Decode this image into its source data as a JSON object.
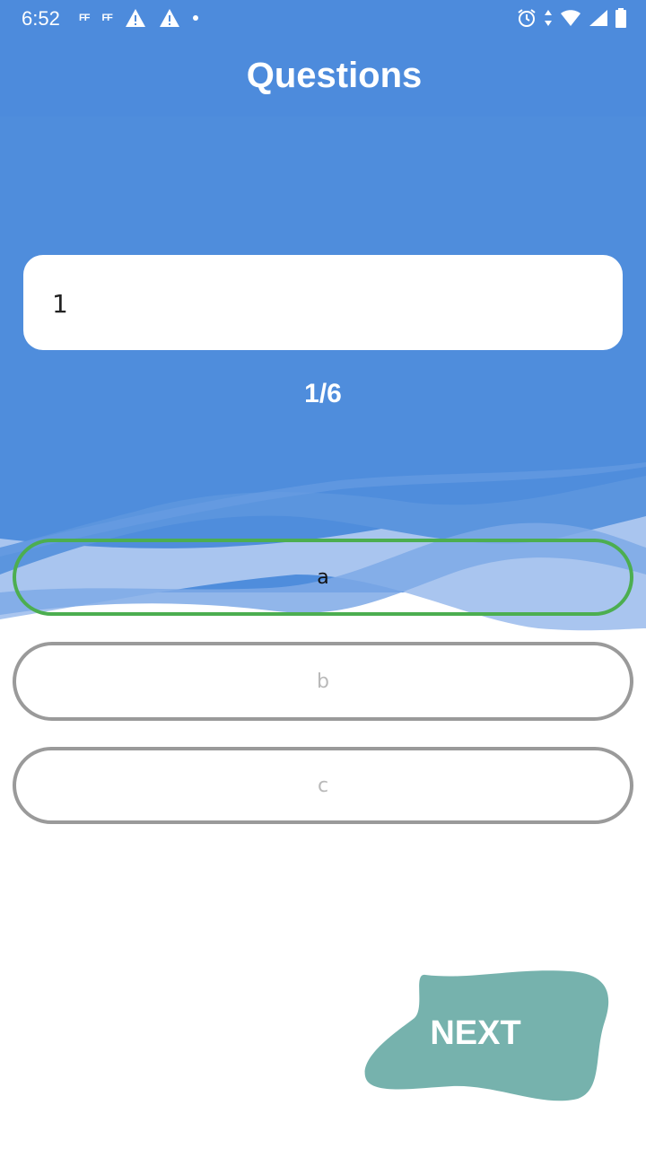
{
  "status_bar": {
    "time": "6:52",
    "left_icons": [
      "ff-icon",
      "ff-icon",
      "warning-icon",
      "warning-icon",
      "dot-icon"
    ],
    "ff_label": "FF",
    "right_icons": [
      "alarm-icon",
      "data-arrows-icon",
      "wifi-icon",
      "signal-icon",
      "battery-icon"
    ]
  },
  "app_bar": {
    "title": "Questions"
  },
  "question": {
    "text": "1"
  },
  "progress": {
    "text": "1/6",
    "current": 1,
    "total": 6
  },
  "options": [
    {
      "label": "a",
      "selected": true
    },
    {
      "label": "b",
      "selected": false
    },
    {
      "label": "c",
      "selected": false
    }
  ],
  "next_button": {
    "label": "NEXT"
  },
  "colors": {
    "primary_blue": "#4f8ddc",
    "wave_light": "#a9c5ef",
    "selected_border": "#4cae50",
    "unselected_border": "#9a9a9a",
    "next_blob": "#76b2ad"
  }
}
